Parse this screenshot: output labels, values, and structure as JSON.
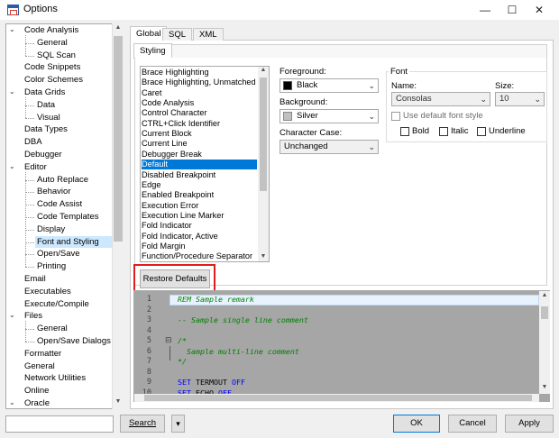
{
  "window": {
    "title": "Options",
    "minimize_glyph": "—",
    "maximize_glyph": "☐",
    "close_glyph": "✕"
  },
  "tree": {
    "items": [
      {
        "label": "Code Analysis",
        "level": 0,
        "expander": "expanded"
      },
      {
        "label": "General",
        "level": 1
      },
      {
        "label": "SQL Scan",
        "level": 1
      },
      {
        "label": "Code Snippets",
        "level": 0
      },
      {
        "label": "Color Schemes",
        "level": 0
      },
      {
        "label": "Data Grids",
        "level": 0,
        "expander": "expanded"
      },
      {
        "label": "Data",
        "level": 1
      },
      {
        "label": "Visual",
        "level": 1
      },
      {
        "label": "Data Types",
        "level": 0
      },
      {
        "label": "DBA",
        "level": 0
      },
      {
        "label": "Debugger",
        "level": 0
      },
      {
        "label": "Editor",
        "level": 0,
        "expander": "expanded"
      },
      {
        "label": "Auto Replace",
        "level": 1
      },
      {
        "label": "Behavior",
        "level": 1
      },
      {
        "label": "Code Assist",
        "level": 1
      },
      {
        "label": "Code Templates",
        "level": 1
      },
      {
        "label": "Display",
        "level": 1
      },
      {
        "label": "Font and Styling",
        "level": 1,
        "selected": true
      },
      {
        "label": "Open/Save",
        "level": 1
      },
      {
        "label": "Printing",
        "level": 1
      },
      {
        "label": "Email",
        "level": 0
      },
      {
        "label": "Executables",
        "level": 0
      },
      {
        "label": "Execute/Compile",
        "level": 0
      },
      {
        "label": "Files",
        "level": 0,
        "expander": "expanded"
      },
      {
        "label": "General",
        "level": 1
      },
      {
        "label": "Open/Save Dialogs",
        "level": 1
      },
      {
        "label": "Formatter",
        "level": 0
      },
      {
        "label": "General",
        "level": 0
      },
      {
        "label": "Network Utilities",
        "level": 0
      },
      {
        "label": "Online",
        "level": 0
      },
      {
        "label": "Oracle",
        "level": 0,
        "expander": "expanded"
      }
    ],
    "scroll_up": "▲",
    "scroll_down": "▼"
  },
  "tabs": [
    {
      "label": "Global",
      "active": true
    },
    {
      "label": "SQL"
    },
    {
      "label": "XML"
    }
  ],
  "subtabs": [
    {
      "label": "Styling",
      "active": true
    }
  ],
  "elements": {
    "items": [
      "Brace Highlighting",
      "Brace Highlighting, Unmatched",
      "Caret",
      "Code Analysis",
      "Control Character",
      "CTRL+Click Identifier",
      "Current Block",
      "Current Line",
      "Debugger Break",
      "Default",
      "Disabled Breakpoint",
      "Edge",
      "Enabled Breakpoint",
      "Execution Error",
      "Execution Line Marker",
      "Fold Indicator",
      "Fold Indicator, Active",
      "Fold Margin",
      "Function/Procedure Separator"
    ],
    "selected_index": 9
  },
  "foreground": {
    "label": "Foreground:",
    "value": "Black",
    "swatch_color": "#000000"
  },
  "background": {
    "label": "Background:",
    "value": "Silver",
    "swatch_color": "#c0c0c0"
  },
  "character_case": {
    "label": "Character Case:",
    "value": "Unchanged"
  },
  "font": {
    "group_label": "Font",
    "name_label": "Name:",
    "name_value": "Consolas",
    "size_label": "Size:",
    "size_value": "10",
    "use_default_label": "Use default font style",
    "bold_label": "Bold",
    "italic_label": "Italic",
    "underline_label": "Underline"
  },
  "restore_defaults_label": "Restore Defaults",
  "editor": {
    "lines": [
      {
        "num": "1",
        "tokens": [
          {
            "t": "REM Sample remark",
            "c": "c-comment"
          }
        ]
      },
      {
        "num": "2",
        "tokens": []
      },
      {
        "num": "3",
        "tokens": [
          {
            "t": "-- Sample single line comment",
            "c": "c-comment"
          }
        ]
      },
      {
        "num": "4",
        "tokens": []
      },
      {
        "num": "5",
        "tokens": [
          {
            "t": "/*",
            "c": "c-comment"
          }
        ]
      },
      {
        "num": "6",
        "tokens": [
          {
            "t": "  Sample multi-line comment",
            "c": "c-comment"
          }
        ]
      },
      {
        "num": "7",
        "tokens": [
          {
            "t": "*/",
            "c": "c-comment"
          }
        ]
      },
      {
        "num": "8",
        "tokens": []
      },
      {
        "num": "9",
        "tokens": [
          {
            "t": "SET ",
            "c": "c-kw"
          },
          {
            "t": "TERMOUT ",
            "c": "c-plain"
          },
          {
            "t": "OFF",
            "c": "c-kw"
          }
        ]
      },
      {
        "num": "10",
        "tokens": [
          {
            "t": "SET ",
            "c": "c-kw"
          },
          {
            "t": "ECHO ",
            "c": "c-plain"
          },
          {
            "t": "OFF",
            "c": "c-kw"
          }
        ]
      }
    ],
    "fold_glyph": "⊟"
  },
  "bottom": {
    "search_value": "",
    "search_label": "Search",
    "dropdown_glyph": "▾",
    "ok_label": "OK",
    "cancel_label": "Cancel",
    "apply_label": "Apply"
  },
  "colors": {
    "selection_blue": "#0078d7",
    "tree_selected": "#cce8ff",
    "highlight_red": "#e21b1b",
    "editor_bg": "#a6a6a6",
    "comment_green": "#008000",
    "keyword_blue": "#0000ff"
  }
}
